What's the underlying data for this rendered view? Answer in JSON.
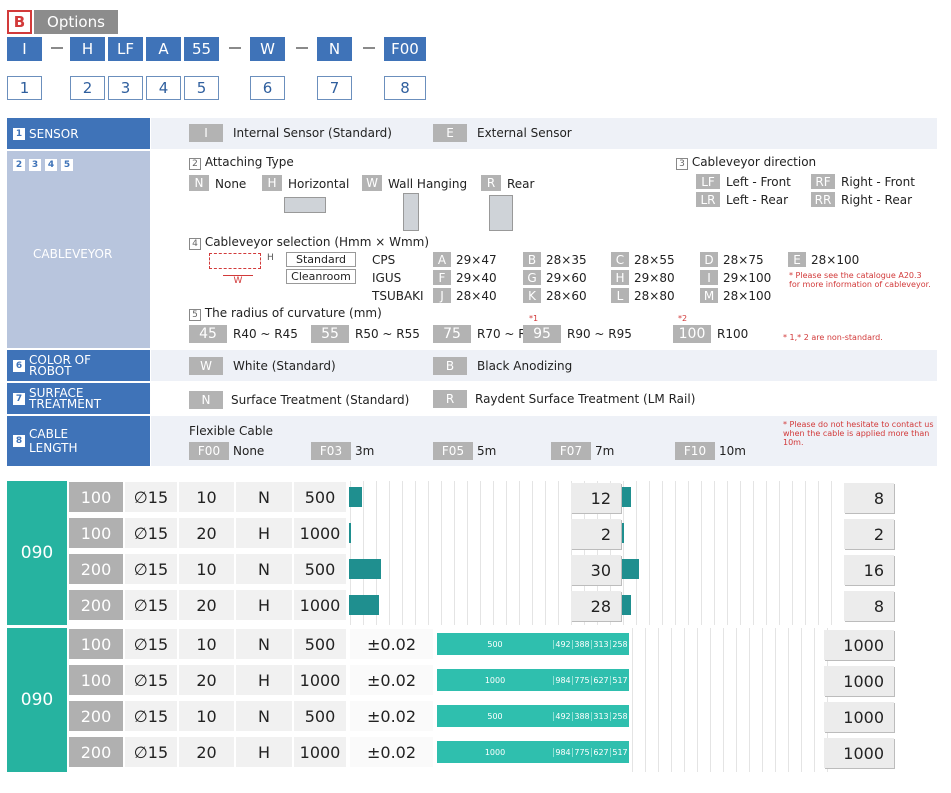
{
  "header": {
    "badge": "B",
    "title": "Options",
    "code": [
      {
        "code": "I",
        "num": "1"
      },
      {
        "code": "H",
        "num": "2"
      },
      {
        "code": "LF",
        "num": "3"
      },
      {
        "code": "A",
        "num": "4"
      },
      {
        "code": "55",
        "num": "5"
      },
      {
        "code": "W",
        "num": "6"
      },
      {
        "code": "N",
        "num": "7"
      },
      {
        "code": "F00",
        "num": "8"
      }
    ]
  },
  "sensor": {
    "num": "1",
    "label": "SENSOR",
    "opts": [
      {
        "code": "I",
        "text": "Internal Sensor (Standard)"
      },
      {
        "code": "E",
        "text": "External Sensor"
      }
    ]
  },
  "cableveyor": {
    "nums": [
      "2",
      "3",
      "4",
      "5"
    ],
    "label": "CABLEVEYOR",
    "attach": {
      "num": "2",
      "title": "Attaching Type",
      "opts": [
        {
          "code": "N",
          "text": "None"
        },
        {
          "code": "H",
          "text": "Horizontal"
        },
        {
          "code": "W",
          "text": "Wall Hanging"
        },
        {
          "code": "R",
          "text": "Rear"
        }
      ]
    },
    "direction": {
      "num": "3",
      "title": "Cableveyor direction",
      "opts": [
        {
          "code": "LF",
          "text": "Left - Front"
        },
        {
          "code": "RF",
          "text": "Right - Front"
        },
        {
          "code": "LR",
          "text": "Left - Rear"
        },
        {
          "code": "RR",
          "text": "Right - Rear"
        }
      ]
    },
    "selection": {
      "num": "4",
      "title": "Cableveyor selection (Hmm × Wmm)",
      "w_label": "W",
      "h_label": "H",
      "btn_standard": "Standard",
      "btn_cleanroom": "Cleanroom",
      "makers": [
        "CPS",
        "IGUS",
        "TSUBAKI"
      ],
      "grid": [
        [
          {
            "c": "A",
            "v": "29×47"
          },
          {
            "c": "B",
            "v": "28×35"
          },
          {
            "c": "C",
            "v": "28×55"
          },
          {
            "c": "D",
            "v": "28×75"
          },
          {
            "c": "E",
            "v": "28×100"
          }
        ],
        [
          {
            "c": "F",
            "v": "29×40"
          },
          {
            "c": "G",
            "v": "29×60"
          },
          {
            "c": "H",
            "v": "29×80"
          },
          {
            "c": "I",
            "v": "29×100"
          }
        ],
        [
          {
            "c": "J",
            "v": "28×40"
          },
          {
            "c": "K",
            "v": "28×60"
          },
          {
            "c": "L",
            "v": "28×80"
          },
          {
            "c": "M",
            "v": "28×100"
          }
        ]
      ],
      "note": "* Please see the catalogue A20.3 for more information of cableveyor."
    },
    "radius": {
      "num": "5",
      "title": "The radius of curvature (mm)",
      "opts": [
        {
          "c": "45",
          "v": "R40 ~ R45",
          "sup": ""
        },
        {
          "c": "55",
          "v": "R50 ~ R55",
          "sup": ""
        },
        {
          "c": "75",
          "v": "R70 ~ R75",
          "sup": ""
        },
        {
          "c": "95",
          "v": "R90 ~ R95",
          "sup": "*1"
        },
        {
          "c": "100",
          "v": "R100",
          "sup": "*2"
        }
      ],
      "note": "* 1,* 2 are non-standard."
    }
  },
  "color": {
    "num": "6",
    "label": "COLOR OF ROBOT",
    "opts": [
      {
        "code": "W",
        "text": "White (Standard)"
      },
      {
        "code": "B",
        "text": "Black Anodizing"
      }
    ]
  },
  "surface": {
    "num": "7",
    "label": "SURFACE TREATMENT",
    "opts": [
      {
        "code": "N",
        "text": "Surface Treatment (Standard)"
      },
      {
        "code": "R",
        "text": "Raydent Surface Treatment (LM Rail)"
      }
    ]
  },
  "cable": {
    "num": "8",
    "label": "CABLE LENGTH",
    "title": "Flexible Cable",
    "opts": [
      {
        "code": "F00",
        "text": "None"
      },
      {
        "code": "F03",
        "text": "3m"
      },
      {
        "code": "F05",
        "text": "5m"
      },
      {
        "code": "F07",
        "text": "7m"
      },
      {
        "code": "F10",
        "text": "10m"
      }
    ],
    "note": "* Please do not hesitate to contact us when the cable is applied more than 10m."
  },
  "table1": {
    "group": "090",
    "rows": [
      {
        "a": "100",
        "b": "∅15",
        "c": "10",
        "d": "N",
        "e": "500",
        "bar1": 0.4,
        "v1": "12",
        "bar2": 0.5,
        "v2": "8"
      },
      {
        "a": "100",
        "b": "∅15",
        "c": "20",
        "d": "H",
        "e": "1000",
        "bar1": 0.07,
        "v1": "2",
        "bar2": 0.1,
        "v2": "2"
      },
      {
        "a": "200",
        "b": "∅15",
        "c": "10",
        "d": "N",
        "e": "500",
        "bar1": 1.0,
        "v1": "30",
        "bar2": 1.0,
        "v2": "16"
      },
      {
        "a": "200",
        "b": "∅15",
        "c": "20",
        "d": "H",
        "e": "1000",
        "bar1": 0.93,
        "v1": "28",
        "bar2": 0.5,
        "v2": "8"
      }
    ]
  },
  "table2": {
    "group": "090",
    "rows": [
      {
        "a": "100",
        "b": "∅15",
        "c": "10",
        "d": "N",
        "e": "500",
        "f": "±0.02",
        "s": [
          "500",
          "492",
          "388",
          "313",
          "258"
        ],
        "g": "1000"
      },
      {
        "a": "100",
        "b": "∅15",
        "c": "20",
        "d": "H",
        "e": "1000",
        "f": "±0.02",
        "s": [
          "1000",
          "984",
          "775",
          "627",
          "517"
        ],
        "g": "1000"
      },
      {
        "a": "200",
        "b": "∅15",
        "c": "10",
        "d": "N",
        "e": "500",
        "f": "±0.02",
        "s": [
          "500",
          "492",
          "388",
          "313",
          "258"
        ],
        "g": "1000"
      },
      {
        "a": "200",
        "b": "∅15",
        "c": "20",
        "d": "H",
        "e": "1000",
        "f": "±0.02",
        "s": [
          "1000",
          "984",
          "775",
          "627",
          "517"
        ],
        "g": "1000"
      }
    ]
  },
  "colors": {
    "blue": "#3f73b8",
    "teal": "#26b3a0",
    "darkteal": "#1f8f8f",
    "gray": "#b3b3b3",
    "red": "#d23a3a"
  }
}
